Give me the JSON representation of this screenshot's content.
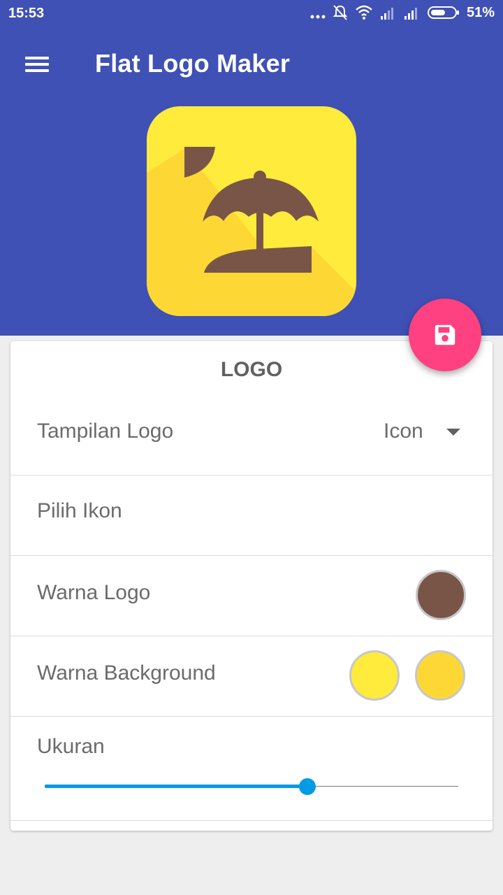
{
  "status_bar": {
    "time": "15:53",
    "battery_percent": "51%",
    "icons": [
      "more-dots-icon",
      "notifications-off-icon",
      "wifi-icon",
      "signal-icon",
      "signal-icon",
      "battery-icon"
    ]
  },
  "toolbar": {
    "title": "Flat Logo Maker",
    "menu_icon": "hamburger-menu-icon"
  },
  "preview": {
    "icon": "beach-umbrella-icon",
    "background_color": "#ffeb3b",
    "long_shadow_color": "#fdd835",
    "icon_color": "#795548"
  },
  "fab": {
    "icon": "save-icon",
    "color": "#ff4081"
  },
  "card": {
    "title": "LOGO",
    "tampilan_logo": {
      "label": "Tampilan Logo",
      "value": "Icon"
    },
    "pilih_ikon": {
      "label": "Pilih Ikon"
    },
    "warna_logo": {
      "label": "Warna Logo",
      "color": "#795548"
    },
    "warna_background": {
      "label": "Warna Background",
      "colors": [
        "#ffeb3b",
        "#fdd835"
      ]
    },
    "ukuran": {
      "label": "Ukuran",
      "value_fraction": 0.635
    }
  },
  "colors": {
    "primary": "#3f51b5",
    "accent": "#ff4081",
    "slider": "#039be5"
  }
}
